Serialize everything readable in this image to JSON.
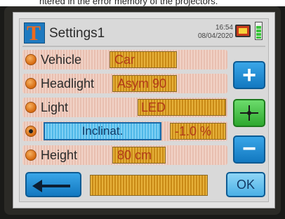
{
  "caption_fragment": "ntered in the error memory of the projectors.",
  "header": {
    "logo_letter": "T",
    "title": "Settings1",
    "time": "16:54",
    "date": "08/04/2020"
  },
  "rows": [
    {
      "label": "Vehicle",
      "value": "Car"
    },
    {
      "label": "Headlight",
      "value": "Asym 90"
    },
    {
      "label": "Light",
      "value": "LED"
    },
    {
      "label": "Inclinat.",
      "value": "-1.0 %"
    },
    {
      "label": "Height",
      "value": "80 cm"
    }
  ],
  "buttons": {
    "plus": "+",
    "minus": "−",
    "ok": "OK",
    "back": "⟵"
  },
  "colors": {
    "accent_blue": "#1f8ad6",
    "field_orange": "#d99a2a",
    "value_red": "#b23a1a",
    "green_button": "#3dbb3d",
    "selected_radio": "#d66a10"
  }
}
